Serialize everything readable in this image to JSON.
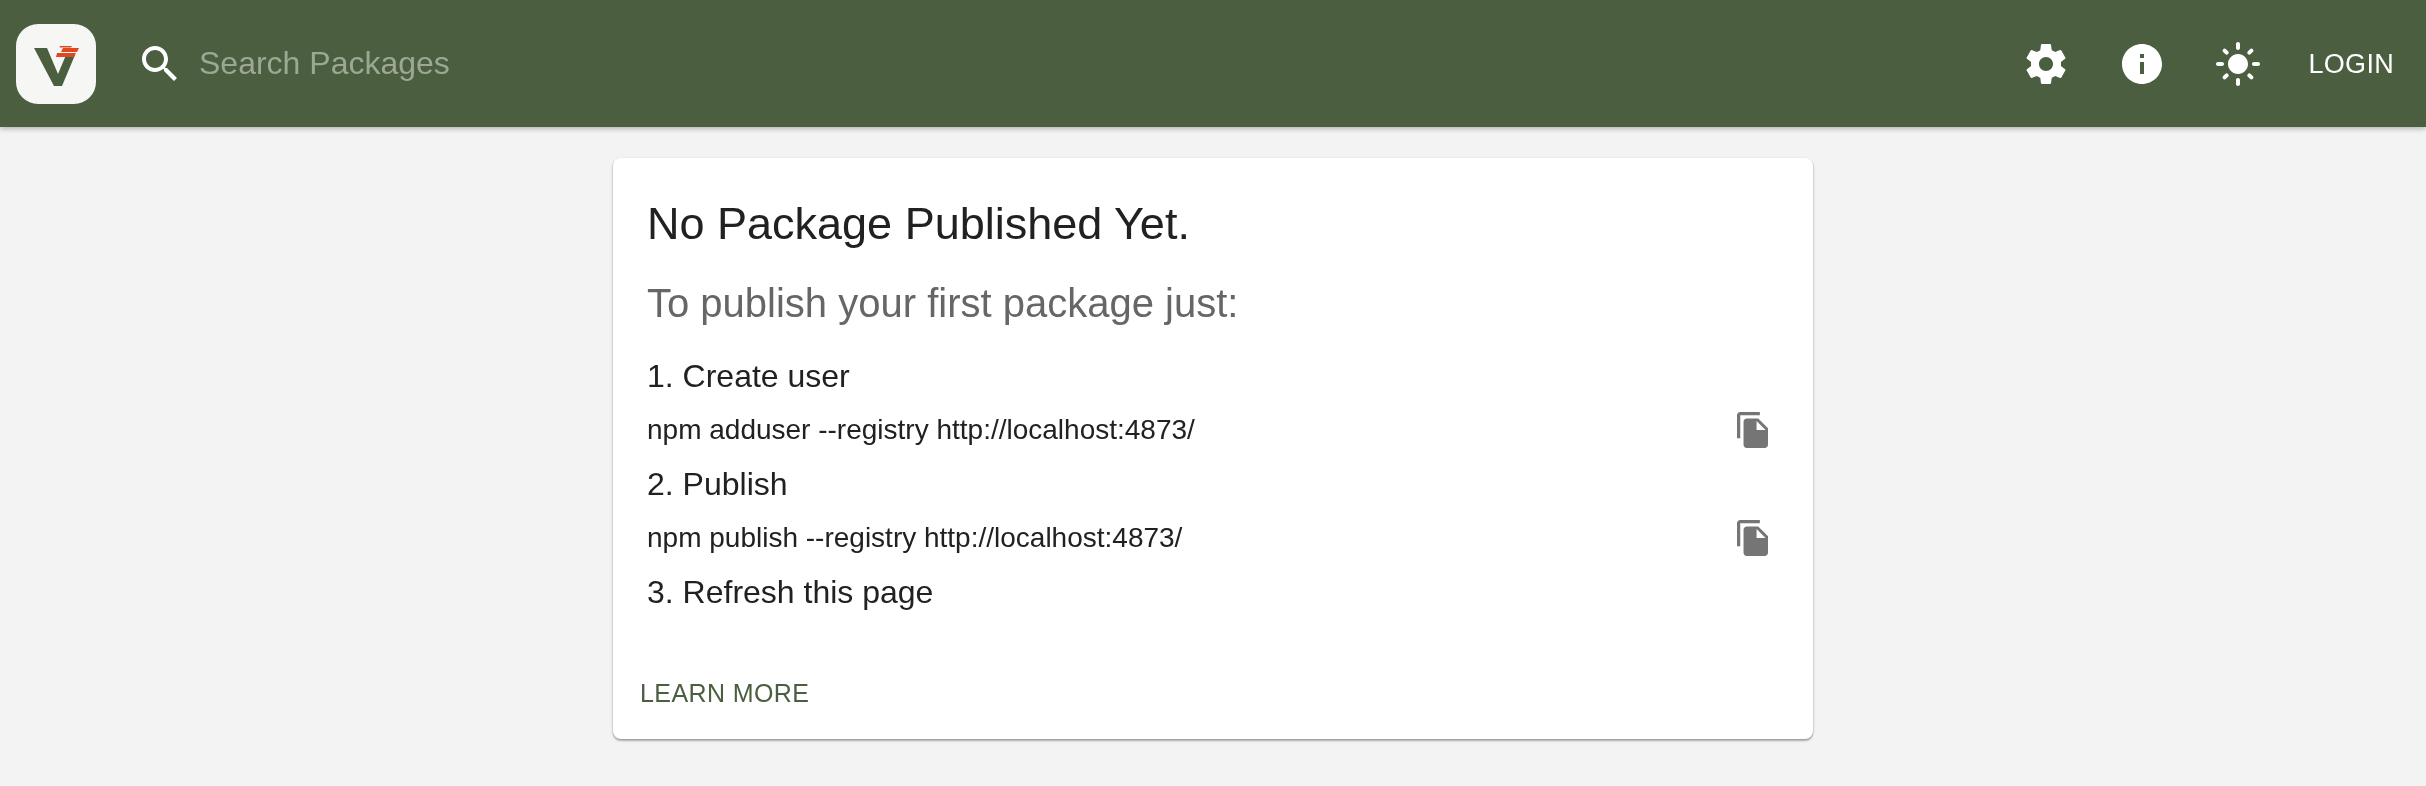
{
  "header": {
    "search": {
      "placeholder": "Search Packages"
    },
    "login": "LOGIN"
  },
  "card": {
    "title": "No Package Published Yet.",
    "subtitle": "To publish your first package just:",
    "steps": [
      {
        "label": "1. Create user",
        "command": "npm adduser --registry http://localhost:4873/"
      },
      {
        "label": "2. Publish",
        "command": "npm publish --registry http://localhost:4873/"
      },
      {
        "label": "3. Refresh this page"
      }
    ],
    "action": "LEARN MORE"
  }
}
